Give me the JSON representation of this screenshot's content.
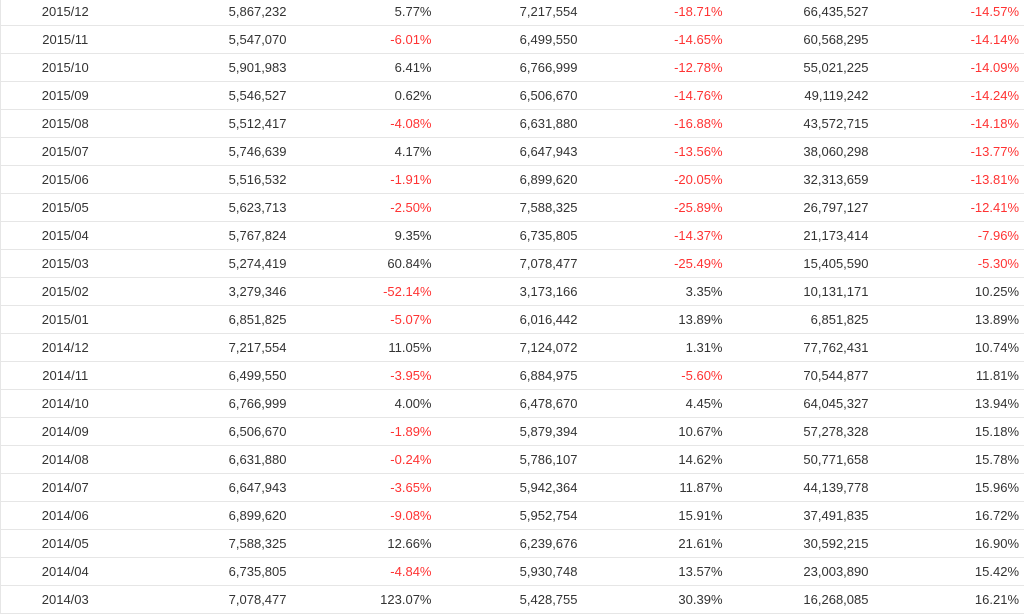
{
  "colors": {
    "negative": "#ff3333",
    "text": "#333333",
    "border": "#e6e6e6"
  },
  "table": {
    "rows": [
      [
        "2015/12",
        "5,867,232",
        "5.77%",
        "7,217,554",
        "-18.71%",
        "66,435,527",
        "-14.57%"
      ],
      [
        "2015/11",
        "5,547,070",
        "-6.01%",
        "6,499,550",
        "-14.65%",
        "60,568,295",
        "-14.14%"
      ],
      [
        "2015/10",
        "5,901,983",
        "6.41%",
        "6,766,999",
        "-12.78%",
        "55,021,225",
        "-14.09%"
      ],
      [
        "2015/09",
        "5,546,527",
        "0.62%",
        "6,506,670",
        "-14.76%",
        "49,119,242",
        "-14.24%"
      ],
      [
        "2015/08",
        "5,512,417",
        "-4.08%",
        "6,631,880",
        "-16.88%",
        "43,572,715",
        "-14.18%"
      ],
      [
        "2015/07",
        "5,746,639",
        "4.17%",
        "6,647,943",
        "-13.56%",
        "38,060,298",
        "-13.77%"
      ],
      [
        "2015/06",
        "5,516,532",
        "-1.91%",
        "6,899,620",
        "-20.05%",
        "32,313,659",
        "-13.81%"
      ],
      [
        "2015/05",
        "5,623,713",
        "-2.50%",
        "7,588,325",
        "-25.89%",
        "26,797,127",
        "-12.41%"
      ],
      [
        "2015/04",
        "5,767,824",
        "9.35%",
        "6,735,805",
        "-14.37%",
        "21,173,414",
        "-7.96%"
      ],
      [
        "2015/03",
        "5,274,419",
        "60.84%",
        "7,078,477",
        "-25.49%",
        "15,405,590",
        "-5.30%"
      ],
      [
        "2015/02",
        "3,279,346",
        "-52.14%",
        "3,173,166",
        "3.35%",
        "10,131,171",
        "10.25%"
      ],
      [
        "2015/01",
        "6,851,825",
        "-5.07%",
        "6,016,442",
        "13.89%",
        "6,851,825",
        "13.89%"
      ],
      [
        "2014/12",
        "7,217,554",
        "11.05%",
        "7,124,072",
        "1.31%",
        "77,762,431",
        "10.74%"
      ],
      [
        "2014/11",
        "6,499,550",
        "-3.95%",
        "6,884,975",
        "-5.60%",
        "70,544,877",
        "11.81%"
      ],
      [
        "2014/10",
        "6,766,999",
        "4.00%",
        "6,478,670",
        "4.45%",
        "64,045,327",
        "13.94%"
      ],
      [
        "2014/09",
        "6,506,670",
        "-1.89%",
        "5,879,394",
        "10.67%",
        "57,278,328",
        "15.18%"
      ],
      [
        "2014/08",
        "6,631,880",
        "-0.24%",
        "5,786,107",
        "14.62%",
        "50,771,658",
        "15.78%"
      ],
      [
        "2014/07",
        "6,647,943",
        "-3.65%",
        "5,942,364",
        "11.87%",
        "44,139,778",
        "15.96%"
      ],
      [
        "2014/06",
        "6,899,620",
        "-9.08%",
        "5,952,754",
        "15.91%",
        "37,491,835",
        "16.72%"
      ],
      [
        "2014/05",
        "7,588,325",
        "12.66%",
        "6,239,676",
        "21.61%",
        "30,592,215",
        "16.90%"
      ],
      [
        "2014/04",
        "6,735,805",
        "-4.84%",
        "5,930,748",
        "13.57%",
        "23,003,890",
        "15.42%"
      ],
      [
        "2014/03",
        "7,078,477",
        "123.07%",
        "5,428,755",
        "30.39%",
        "16,268,085",
        "16.21%"
      ]
    ]
  }
}
